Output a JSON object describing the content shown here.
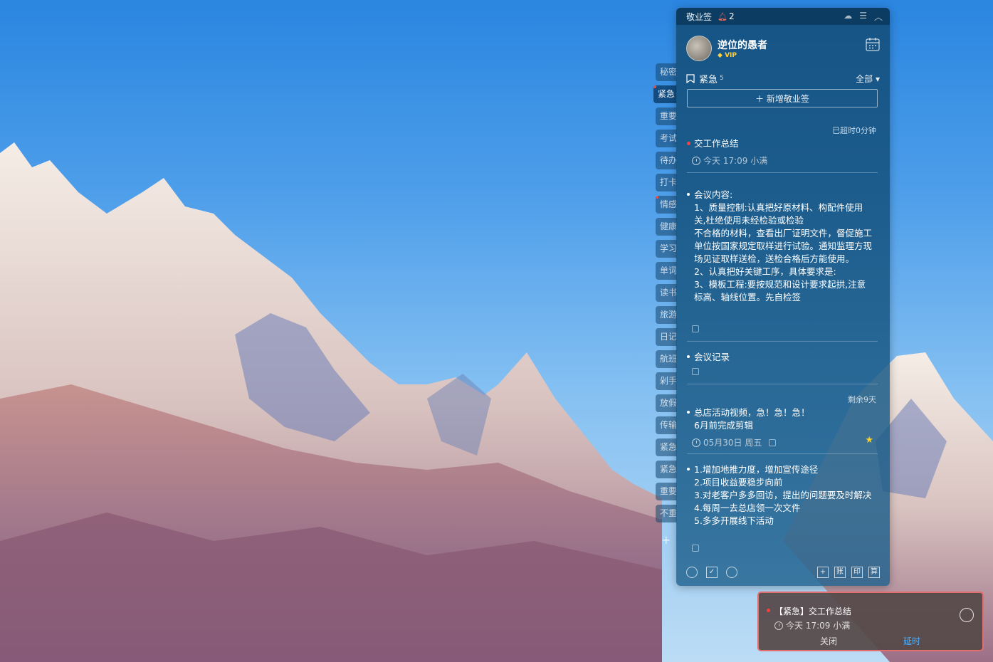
{
  "app": {
    "title": "敬业签",
    "notification_count": "2"
  },
  "user": {
    "name": "逆位的愚者",
    "badge": "VIP"
  },
  "category": {
    "name": "紧急",
    "count": "5",
    "filter": "全部 ▾"
  },
  "add_button": "＋ 新增敬业签",
  "side_tabs": [
    "秘密",
    "紧急",
    "重要",
    "考试",
    "待办",
    "打卡",
    "情感",
    "健康",
    "学习",
    "单词",
    "读书",
    "旅游",
    "日记",
    "航班",
    "剁手",
    "放假",
    "传输",
    "紧急",
    "紧急",
    "重要",
    "不重"
  ],
  "notes": {
    "n1": {
      "status": "已超时0分钟",
      "title": "交工作总结",
      "time": "今天 17:09 小满"
    },
    "n2": {
      "lines": [
        "会议内容:",
        "1、质量控制:认真把好原材料、构配件使用关,杜绝使用未经检验或检验",
        "不合格的材料，查看出厂证明文件，督促施工单位按国家规定取样进行试验。通知监理方现场见证取样送检，送检合格后方能使用。",
        "2、认真把好关键工序，具体要求是:",
        "3、模板工程:要按规范和设计要求起拱,注意标高、轴线位置。先自检签"
      ]
    },
    "n3": {
      "title": "会议记录"
    },
    "n4": {
      "status": "剩余9天",
      "line1": "总店活动视频，急！急！急！",
      "line2": "6月前完成剪辑",
      "date": "05月30日 周五"
    },
    "n5": {
      "lines": [
        "1.增加地推力度，增加宣传途径",
        "2.项目收益要稳步向前",
        "3.对老客户多多回访，提出的问题要及时解决",
        "4.每周一去总店领一次文件",
        "5.多多开展线下活动"
      ]
    }
  },
  "footer": {
    "right": [
      "+",
      "账",
      "印",
      "算"
    ]
  },
  "popup": {
    "title": "【紧急】交工作总结",
    "time": "今天 17:09 小满",
    "close": "关闭",
    "delay": "延时"
  },
  "colors": {
    "panel": "#1b5c86",
    "accent_red": "#ff4040",
    "star": "#ffd21f",
    "link_blue": "#4fb2ff"
  }
}
